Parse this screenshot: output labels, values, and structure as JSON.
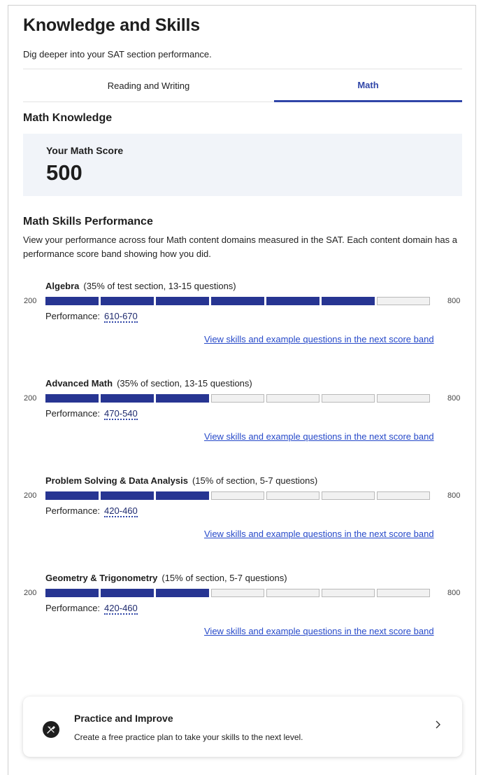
{
  "header": {
    "title": "Knowledge and Skills",
    "subtitle": "Dig deeper into your SAT section performance."
  },
  "tabs": [
    {
      "label": "Reading and Writing",
      "active": false
    },
    {
      "label": "Math",
      "active": true
    }
  ],
  "math_knowledge": {
    "heading": "Math Knowledge",
    "score_label": "Your Math Score",
    "score": "500"
  },
  "skills": {
    "heading": "Math Skills Performance",
    "description": "View your performance across four Math content domains measured in the SAT. Each content domain has a performance score band showing how you did.",
    "axis_min": "200",
    "axis_max": "800",
    "domains": [
      {
        "name": "Algebra",
        "meta": "(35% of test section, 13-15 questions)",
        "performance_label": "Performance:",
        "range": "610-670",
        "filled_segments": 6,
        "total_segments": 7,
        "link": "View skills and example questions in the next score band"
      },
      {
        "name": "Advanced Math",
        "meta": "(35% of section, 13-15 questions)",
        "performance_label": "Performance:",
        "range": "470-540",
        "filled_segments": 3,
        "total_segments": 7,
        "link": "View skills and example questions in the next score band"
      },
      {
        "name": "Problem Solving & Data Analysis",
        "meta": "(15% of section, 5-7 questions)",
        "performance_label": "Performance:",
        "range": "420-460",
        "filled_segments": 3,
        "total_segments": 7,
        "link": "View skills and example questions in the next score band"
      },
      {
        "name": "Geometry & Trigonometry",
        "meta": "(15% of section, 5-7 questions)",
        "performance_label": "Performance:",
        "range": "420-460",
        "filled_segments": 3,
        "total_segments": 7,
        "link": "View skills and example questions in the next score band"
      }
    ]
  },
  "practice": {
    "title": "Practice and Improve",
    "description": "Create a free practice plan to take your skills to the next level.",
    "icon": "pencil-ruler-icon",
    "chevron": "chevron-right-icon"
  },
  "colors": {
    "accent": "#3046a8",
    "bar_filled": "#273592",
    "bar_empty": "#f1f1f1",
    "link": "#2649c9",
    "score_bg": "#f1f4f9"
  }
}
